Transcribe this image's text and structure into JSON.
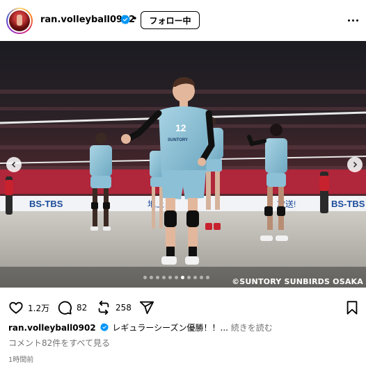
{
  "header": {
    "username": "ran.volleyball0902",
    "separator": "•",
    "follow_label": "フォロー中"
  },
  "photo": {
    "watermark": "©SUNTORY SUNBIRDS OSAKA",
    "board_text_left": "BS-TBS",
    "board_text_right": "BS-TBS",
    "board_text_mid": "地上",
    "board_text_mid2": "放送!",
    "jersey_number": "12",
    "jersey_brand": "SUNTORY",
    "carousel_total": 11,
    "carousel_active": 7
  },
  "actions": {
    "likes": "1.2万",
    "comments": "82",
    "reposts": "258"
  },
  "caption": {
    "username": "ran.volleyball0902",
    "text": "レギュラーシーズン優勝！！...",
    "more": "続きを読む"
  },
  "comments_link": "コメント82件をすべて見る",
  "timestamp": "1時間前",
  "colors": {
    "verified": "#0095f6",
    "jersey": "#8fc3d8",
    "court": "#d9d7d2",
    "crowd": "#3a1e22"
  }
}
